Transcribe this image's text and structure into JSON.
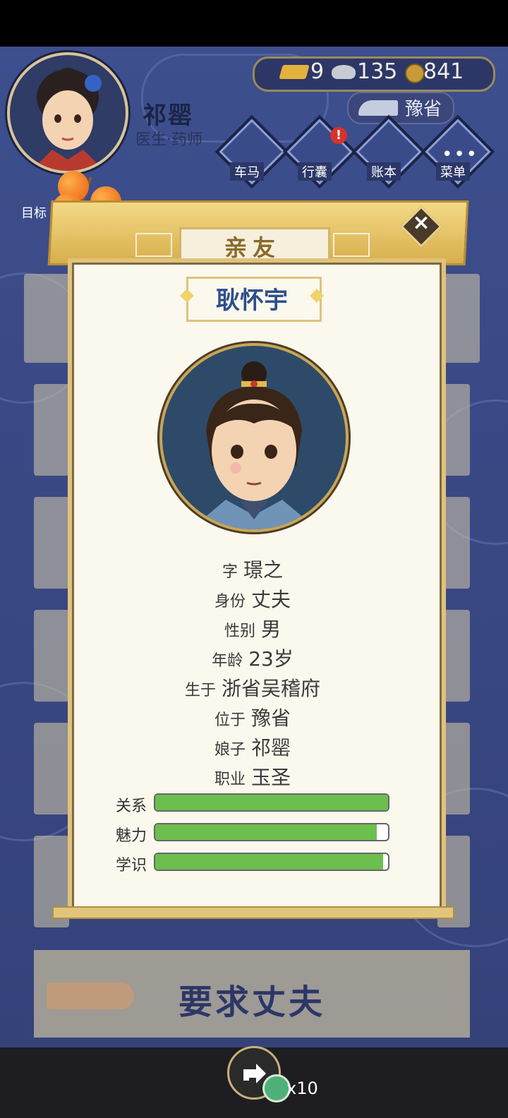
{
  "header": {
    "player_name": "祁罂",
    "player_job": "医生·药师",
    "currency": {
      "gold": "9",
      "silver": "135",
      "coins": "841"
    },
    "province": "豫省",
    "nav": [
      {
        "label": "车马",
        "icon": "carriage-icon"
      },
      {
        "label": "行囊",
        "icon": "bag-icon"
      },
      {
        "label": "账本",
        "icon": "ledger-icon"
      },
      {
        "label": "菜单",
        "icon": "menu-icon"
      }
    ],
    "target_label": "目标"
  },
  "modal": {
    "tab_label": "亲友",
    "person_name": "耿怀宇",
    "info": [
      {
        "label": "字",
        "value": "璟之"
      },
      {
        "label": "身份",
        "value": "丈夫"
      },
      {
        "label": "性别",
        "value": "男"
      },
      {
        "label": "年龄",
        "value": "23岁"
      },
      {
        "label": "生于",
        "value": "浙省吴稽府"
      },
      {
        "label": "位于",
        "value": "豫省"
      },
      {
        "label": "娘子",
        "value": "祁罂"
      },
      {
        "label": "职业",
        "value": "玉圣"
      }
    ],
    "stats": [
      {
        "label": "关系",
        "value": 1.0
      },
      {
        "label": "魅力",
        "value": 0.95
      },
      {
        "label": "学识",
        "value": 0.98
      }
    ]
  },
  "action": {
    "label": "要求丈夫"
  },
  "share": {
    "count": "x10"
  },
  "colors": {
    "accent": "#d8ae4b",
    "bar": "#6cbf4e",
    "navy": "#2c3768"
  }
}
